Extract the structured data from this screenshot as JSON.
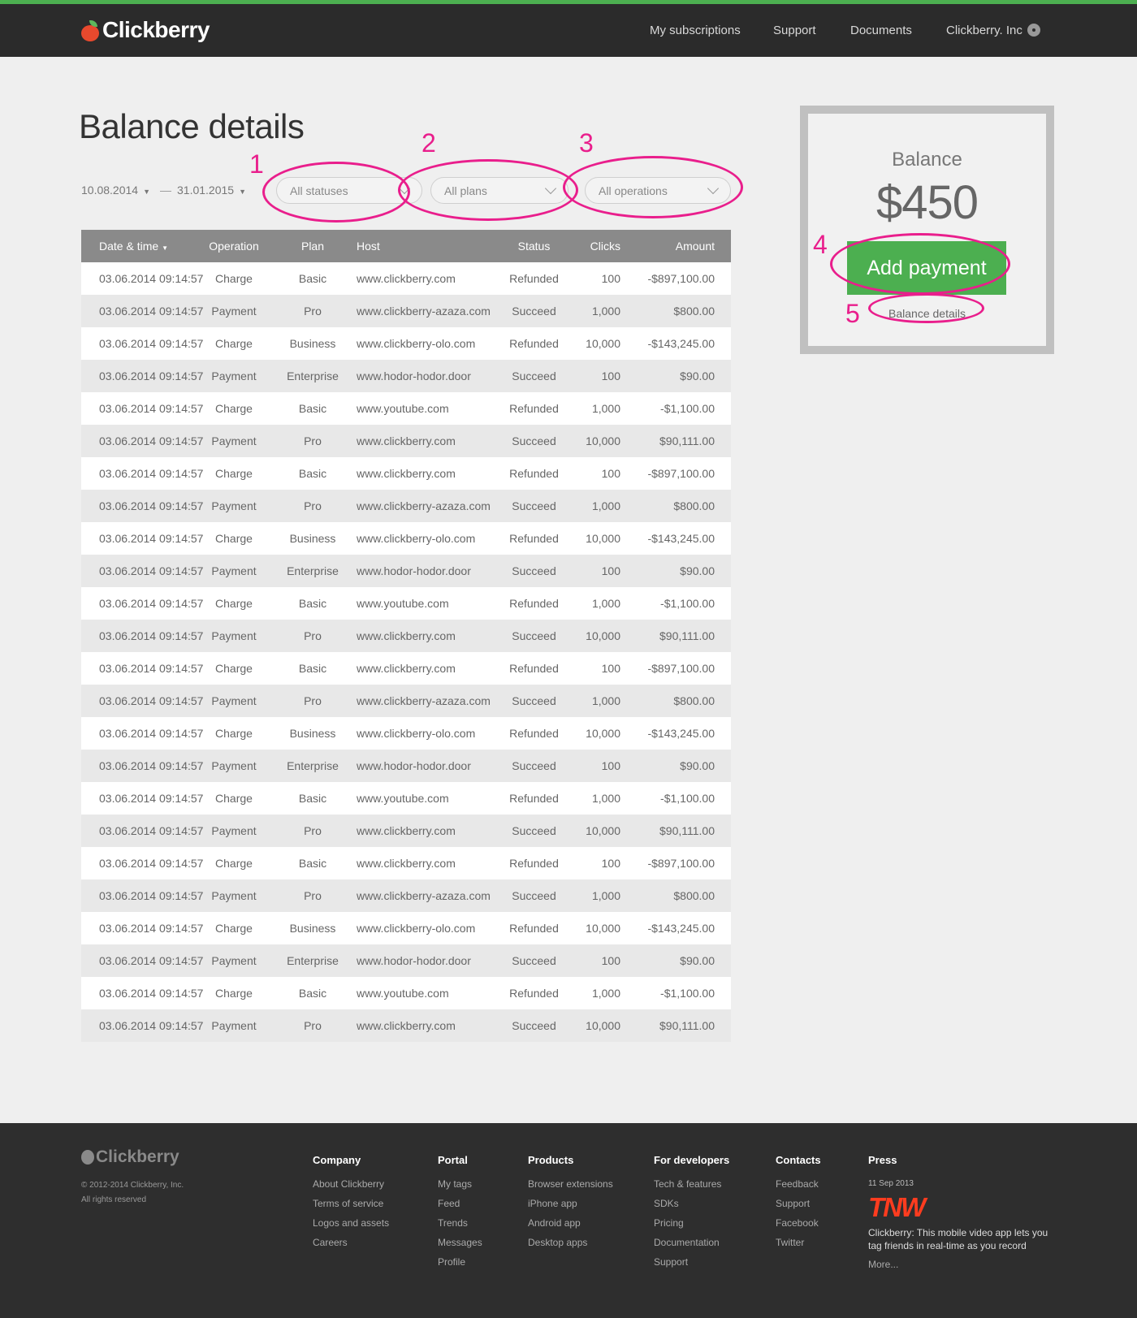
{
  "brand": {
    "name": "Clickberry"
  },
  "nav": {
    "items": [
      "My subscriptions",
      "Support",
      "Documents",
      "Clickberry. Inc"
    ]
  },
  "page": {
    "title": "Balance details"
  },
  "filters": {
    "date_from": "10.08.2014",
    "date_sep": "—",
    "date_to": "31.01.2015",
    "status": "All statuses",
    "plan": "All plans",
    "operation": "All operations"
  },
  "annotations": [
    "1",
    "2",
    "3",
    "4",
    "5"
  ],
  "table": {
    "headers": {
      "date": "Date & time",
      "operation": "Operation",
      "plan": "Plan",
      "host": "Host",
      "status": "Status",
      "clicks": "Clicks",
      "amount": "Amount"
    },
    "rows": [
      [
        "03.06.2014  09:14:57",
        "Charge",
        "Basic",
        "www.clickberry.com",
        "Refunded",
        "100",
        "-$897,100.00"
      ],
      [
        "03.06.2014  09:14:57",
        "Payment",
        "Pro",
        "www.clickberry-azaza.com",
        "Succeed",
        "1,000",
        "$800.00"
      ],
      [
        "03.06.2014  09:14:57",
        "Charge",
        "Business",
        "www.clickberry-olo.com",
        "Refunded",
        "10,000",
        "-$143,245.00"
      ],
      [
        "03.06.2014  09:14:57",
        "Payment",
        "Enterprise",
        "www.hodor-hodor.door",
        "Succeed",
        "100",
        "$90.00"
      ],
      [
        "03.06.2014  09:14:57",
        "Charge",
        "Basic",
        "www.youtube.com",
        "Refunded",
        "1,000",
        "-$1,100.00"
      ],
      [
        "03.06.2014  09:14:57",
        "Payment",
        "Pro",
        "www.clickberry.com",
        "Succeed",
        "10,000",
        "$90,111.00"
      ],
      [
        "03.06.2014  09:14:57",
        "Charge",
        "Basic",
        "www.clickberry.com",
        "Refunded",
        "100",
        "-$897,100.00"
      ],
      [
        "03.06.2014  09:14:57",
        "Payment",
        "Pro",
        "www.clickberry-azaza.com",
        "Succeed",
        "1,000",
        "$800.00"
      ],
      [
        "03.06.2014  09:14:57",
        "Charge",
        "Business",
        "www.clickberry-olo.com",
        "Refunded",
        "10,000",
        "-$143,245.00"
      ],
      [
        "03.06.2014  09:14:57",
        "Payment",
        "Enterprise",
        "www.hodor-hodor.door",
        "Succeed",
        "100",
        "$90.00"
      ],
      [
        "03.06.2014  09:14:57",
        "Charge",
        "Basic",
        "www.youtube.com",
        "Refunded",
        "1,000",
        "-$1,100.00"
      ],
      [
        "03.06.2014  09:14:57",
        "Payment",
        "Pro",
        "www.clickberry.com",
        "Succeed",
        "10,000",
        "$90,111.00"
      ],
      [
        "03.06.2014  09:14:57",
        "Charge",
        "Basic",
        "www.clickberry.com",
        "Refunded",
        "100",
        "-$897,100.00"
      ],
      [
        "03.06.2014  09:14:57",
        "Payment",
        "Pro",
        "www.clickberry-azaza.com",
        "Succeed",
        "1,000",
        "$800.00"
      ],
      [
        "03.06.2014  09:14:57",
        "Charge",
        "Business",
        "www.clickberry-olo.com",
        "Refunded",
        "10,000",
        "-$143,245.00"
      ],
      [
        "03.06.2014  09:14:57",
        "Payment",
        "Enterprise",
        "www.hodor-hodor.door",
        "Succeed",
        "100",
        "$90.00"
      ],
      [
        "03.06.2014  09:14:57",
        "Charge",
        "Basic",
        "www.youtube.com",
        "Refunded",
        "1,000",
        "-$1,100.00"
      ],
      [
        "03.06.2014  09:14:57",
        "Payment",
        "Pro",
        "www.clickberry.com",
        "Succeed",
        "10,000",
        "$90,111.00"
      ],
      [
        "03.06.2014  09:14:57",
        "Charge",
        "Basic",
        "www.clickberry.com",
        "Refunded",
        "100",
        "-$897,100.00"
      ],
      [
        "03.06.2014  09:14:57",
        "Payment",
        "Pro",
        "www.clickberry-azaza.com",
        "Succeed",
        "1,000",
        "$800.00"
      ],
      [
        "03.06.2014  09:14:57",
        "Charge",
        "Business",
        "www.clickberry-olo.com",
        "Refunded",
        "10,000",
        "-$143,245.00"
      ],
      [
        "03.06.2014  09:14:57",
        "Payment",
        "Enterprise",
        "www.hodor-hodor.door",
        "Succeed",
        "100",
        "$90.00"
      ],
      [
        "03.06.2014  09:14:57",
        "Charge",
        "Basic",
        "www.youtube.com",
        "Refunded",
        "1,000",
        "-$1,100.00"
      ],
      [
        "03.06.2014  09:14:57",
        "Payment",
        "Pro",
        "www.clickberry.com",
        "Succeed",
        "10,000",
        "$90,111.00"
      ]
    ]
  },
  "balance": {
    "label": "Balance",
    "amount": "$450",
    "add_payment": "Add payment",
    "details_link": "Balance details"
  },
  "footer": {
    "brand": "Clickberry",
    "copyright": "© 2012-2014 Clickberry, Inc.",
    "rights": "All rights reserved",
    "columns": [
      {
        "title": "Company",
        "links": [
          "About Clickberry",
          "Terms of service",
          "Logos and assets",
          "Careers"
        ]
      },
      {
        "title": "Portal",
        "links": [
          "My tags",
          "Feed",
          "Trends",
          "Messages",
          "Profile"
        ]
      },
      {
        "title": "Products",
        "links": [
          "Browser extensions",
          "iPhone app",
          "Android app",
          "Desktop apps"
        ]
      },
      {
        "title": "For developers",
        "links": [
          "Tech & features",
          "SDKs",
          "Pricing",
          "Documentation",
          "Support"
        ]
      },
      {
        "title": "Contacts",
        "links": [
          "Feedback",
          "Support",
          "Facebook",
          "Twitter"
        ]
      }
    ],
    "press": {
      "title": "Press",
      "date": "11 Sep 2013",
      "logo": "TNW",
      "text": "Clickberry: This mobile video app lets you tag friends in real-time as you record",
      "more": "More..."
    }
  },
  "colors": {
    "accent": "#4caf50",
    "annotation": "#e91e8c",
    "header_bg": "#2b2b2b",
    "table_header_bg": "#8a8a8a"
  }
}
